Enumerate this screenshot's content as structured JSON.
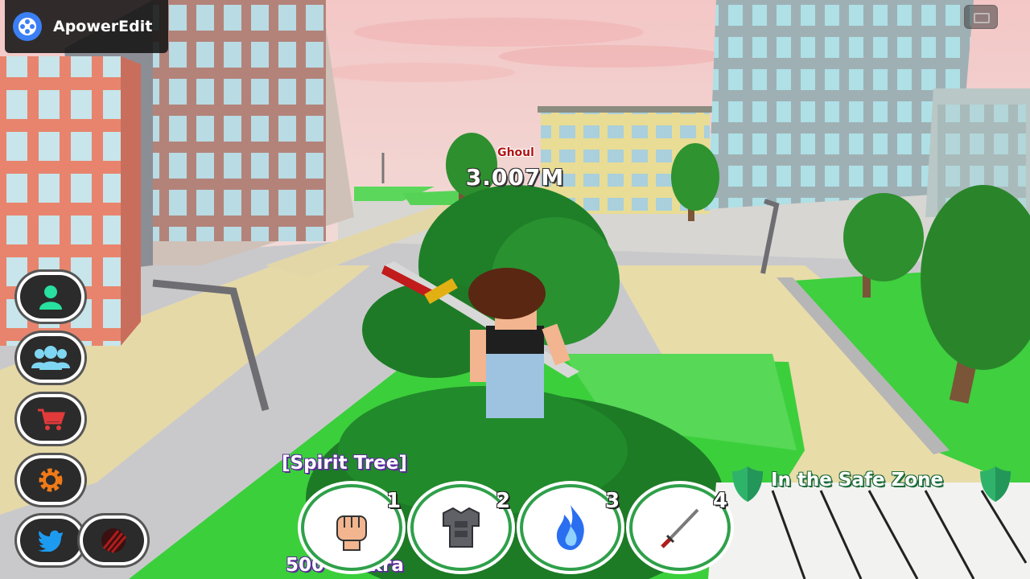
{
  "watermark": {
    "app_name": "ApowerEdit",
    "icon": "film-reel-icon"
  },
  "enemy": {
    "name": "Ghoul",
    "health": "3.007M"
  },
  "side_menu": [
    {
      "icon": "user-icon",
      "color": "#28e0a0"
    },
    {
      "icon": "group-icon",
      "color": "#7fd6f2"
    },
    {
      "icon": "shopping-cart-icon",
      "color": "#e23a3a"
    },
    {
      "icon": "gear-icon",
      "color": "#f07a18"
    },
    {
      "icon": "twitter-icon",
      "color": "#1d9bf0"
    },
    {
      "icon": "claw-marks-icon",
      "color": "#b01c1c"
    }
  ],
  "hud": {
    "area": "[Spirit Tree]",
    "chakra": "500 Chakra",
    "safe_zone": "In the Safe Zone"
  },
  "skills": [
    {
      "number": "1",
      "icon": "fist-icon"
    },
    {
      "number": "2",
      "icon": "armor-icon"
    },
    {
      "number": "3",
      "icon": "blue-flame-icon"
    },
    {
      "number": "4",
      "icon": "sword-icon"
    }
  ],
  "colors": {
    "accent_green": "#2fa04a",
    "ghoul_red": "#b11616",
    "label_purple": "#5a2d9a"
  }
}
